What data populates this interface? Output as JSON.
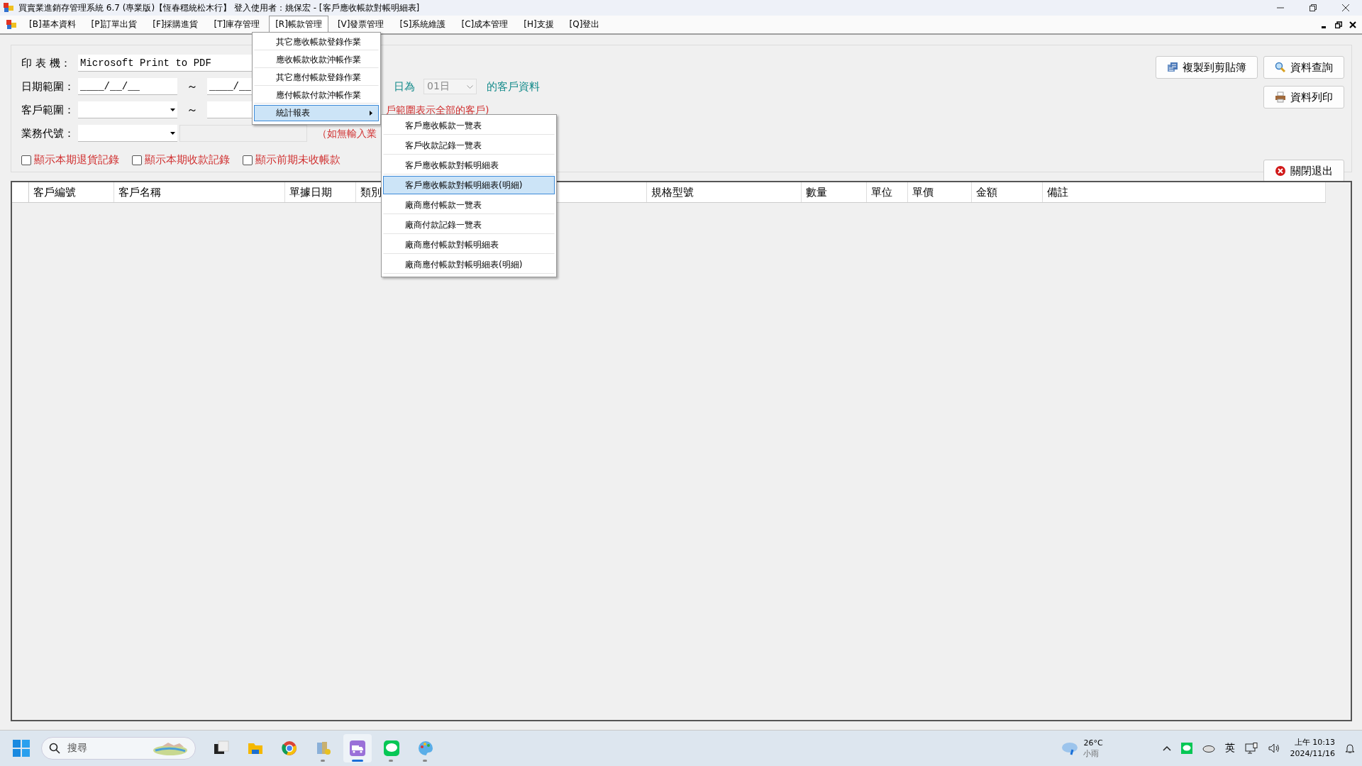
{
  "window": {
    "title": "買賣業進銷存管理系統 6.7 (專業版)【恆春穩統松木行】 登入使用者：姚保宏 - [客戶應收帳款對帳明細表]"
  },
  "menu_bar": {
    "items": [
      {
        "label": "[B]基本資料",
        "selected": false
      },
      {
        "label": "[P]訂單出貨",
        "selected": false
      },
      {
        "label": "[F]採購進貨",
        "selected": false
      },
      {
        "label": "[T]庫存管理",
        "selected": false
      },
      {
        "label": "[R]帳款管理",
        "selected": true
      },
      {
        "label": "[V]發票管理",
        "selected": false
      },
      {
        "label": "[S]系統維護",
        "selected": false
      },
      {
        "label": "[C]成本管理",
        "selected": false
      },
      {
        "label": "[H]支援",
        "selected": false
      },
      {
        "label": "[Q]登出",
        "selected": false
      }
    ]
  },
  "menu": {
    "items": [
      {
        "label": "其它應收帳款登錄作業",
        "selected": false,
        "has_submenu": false
      },
      {
        "label": "應收帳款收款沖帳作業",
        "selected": false,
        "has_submenu": false
      },
      {
        "label": "其它應付帳款登錄作業",
        "selected": false,
        "has_submenu": false
      },
      {
        "label": "應付帳款付款沖帳作業",
        "selected": false,
        "has_submenu": false
      },
      {
        "label": "統計報表",
        "selected": true,
        "has_submenu": true
      }
    ]
  },
  "submenu": {
    "items": [
      {
        "label": "客戶應收帳款一覽表",
        "selected": false
      },
      {
        "label": "客戶收款記錄一覽表",
        "selected": false
      },
      {
        "label": "客戶應收帳款對帳明細表",
        "selected": false
      },
      {
        "label": "客戶應收帳款對帳明細表(明細)",
        "selected": true
      },
      {
        "label": "廠商應付帳款一覽表",
        "selected": false
      },
      {
        "label": "廠商付款記錄一覽表",
        "selected": false
      },
      {
        "label": "廠商應付帳款對帳明細表",
        "selected": false
      },
      {
        "label": "廠商應付帳款對帳明細表(明細)",
        "selected": false
      }
    ]
  },
  "form": {
    "printer_label": "印 表 機：",
    "printer_value": "Microsoft Print to PDF",
    "date_label": "日期範圍：",
    "date_from": "____/__/__",
    "date_to": "____/__",
    "date_tilde": "～",
    "day_label": "日為",
    "day_select": {
      "value": "01日",
      "disabled": true
    },
    "day_suffix": "的客戶資料",
    "customer_label": "客戶範圍：",
    "customer_tilde": "～",
    "customer_note": "戶範圍表示全部的客戶)",
    "sales_label": "業務代號：",
    "sales_note": "（如無輸入業",
    "checkboxes": [
      {
        "label": "顯示本期退貨記錄",
        "checked": false
      },
      {
        "label": "顯示本期收款記錄",
        "checked": false
      },
      {
        "label": "顯示前期未收帳款",
        "checked": false
      }
    ]
  },
  "buttons": [
    {
      "label": "複製到剪貼簿",
      "kind": "copy"
    },
    {
      "label": "資料查詢",
      "kind": "search"
    },
    {
      "label": "資料列印",
      "kind": "print"
    },
    {
      "label": "關閉退出",
      "kind": "close"
    }
  ],
  "table": {
    "columns": [
      "客戶編號",
      "客戶名稱",
      "單據日期",
      "類別",
      "規格型號",
      "數量",
      "單位",
      "單價",
      "金額",
      "備註"
    ]
  },
  "taskbar": {
    "search_placeholder": "搜尋",
    "apps": [
      {
        "kind": "taskview",
        "running": false,
        "selected": false
      },
      {
        "kind": "folder",
        "running": false,
        "selected": false
      },
      {
        "kind": "browser",
        "running": false,
        "selected": false
      },
      {
        "kind": "books",
        "running": true,
        "selected": false
      },
      {
        "kind": "truck",
        "running": true,
        "selected": true
      },
      {
        "kind": "chat",
        "running": true,
        "selected": false
      },
      {
        "kind": "palette",
        "running": true,
        "selected": false
      }
    ],
    "weather": {
      "temperature": "26°C",
      "condition": "小雨"
    },
    "ime": "英",
    "time": "上午 10:13",
    "date": "2024/11/16"
  }
}
